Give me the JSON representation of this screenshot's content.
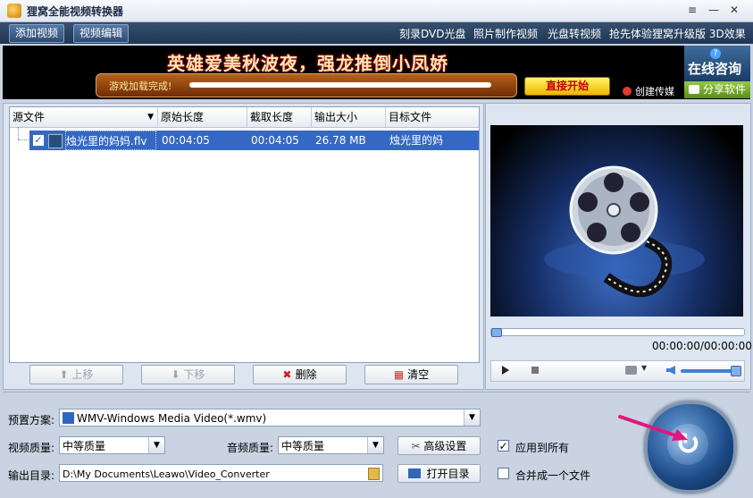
{
  "window": {
    "title": "狸窝全能视频转换器",
    "menu_icon": "≡",
    "minimize_icon": "—",
    "close_icon": "✕"
  },
  "toolbar": {
    "add_video": "添加视频",
    "edit_video": "视频编辑",
    "links": [
      "刻录DVD光盘",
      "照片制作视频",
      "光盘转视频",
      "抢先体验狸窝升级版 3D效果"
    ]
  },
  "banner": {
    "title": "英雄爱美秋波夜，强龙推倒小凤娇",
    "progress_text": "游戏加载完成!",
    "start_button": "直接开始",
    "weibo": "创建传媒",
    "consult": "在线咨询",
    "consult_help": "?",
    "share": "分享软件"
  },
  "file_table": {
    "columns": [
      "源文件",
      "原始长度",
      "截取长度",
      "输出大小",
      "目标文件"
    ],
    "rows": [
      {
        "checked": "✓",
        "source": "烛光里的妈妈.flv",
        "original_length": "00:04:05",
        "clip_length": "00:04:05",
        "output_size": "26.78 MB",
        "target": "烛光里的妈妈.wmv"
      }
    ]
  },
  "list_controls": {
    "up": "上移",
    "down": "下移",
    "delete": "删除",
    "clear": "清空"
  },
  "player": {
    "timecode": "00:00:00/00:00:00",
    "position": 0,
    "volume": 1
  },
  "settings": {
    "preset_label": "预置方案:",
    "preset_value": "WMV-Windows Media Video(*.wmv)",
    "video_quality_label": "视频质量:",
    "video_quality_value": "中等质量",
    "audio_quality_label": "音频质量:",
    "audio_quality_value": "中等质量",
    "advanced": "高级设置",
    "apply_all": "应用到所有",
    "apply_all_checked": "✓",
    "output_label": "输出目录:",
    "output_value": "D:\\My Documents\\Leawo\\Video_Converter",
    "open_dir": "打开目录",
    "merge": "合并成一个文件"
  },
  "colors": {
    "menubar": "#1f3654",
    "selection": "#3568c2",
    "accent_pink": "#e0177c"
  }
}
